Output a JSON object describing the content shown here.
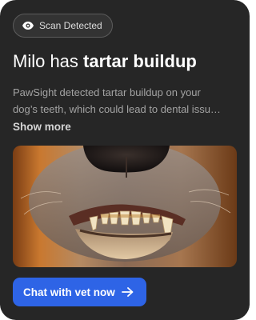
{
  "badge": {
    "label": "Scan Detected",
    "icon": "eye-icon"
  },
  "headline": {
    "lead": "Milo has ",
    "emphasis": "tartar buildup"
  },
  "description": {
    "line1": "PawSight detected tartar buildup on your",
    "line2": "dog’s teeth, which could lead to dental issu…"
  },
  "show_more_label": "Show more",
  "photo": {
    "subject": "close-up of a dog's teeth"
  },
  "cta": {
    "label": "Chat with vet now",
    "icon": "arrow-right-icon"
  },
  "colors": {
    "card_background": "#262626",
    "accent": "#2e64e6",
    "body_text": "#a3a3a3"
  }
}
